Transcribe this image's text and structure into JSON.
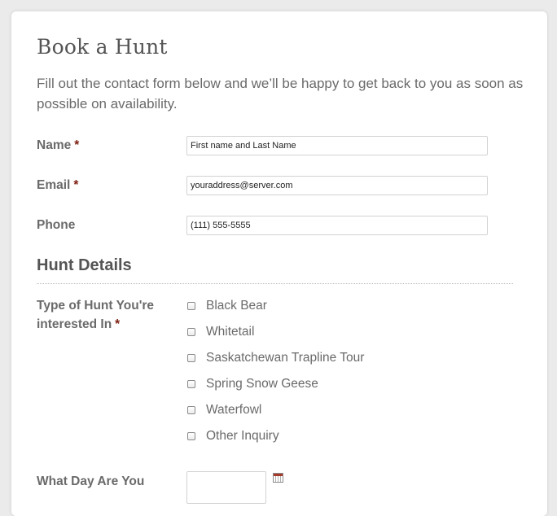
{
  "page": {
    "title": "Book a Hunt",
    "intro": "Fill out the contact form below and we’ll be happy to get back to you as soon as possible on availability."
  },
  "form": {
    "name": {
      "label": "Name",
      "required_mark": "*",
      "value": "First name and Last Name"
    },
    "email": {
      "label": "Email",
      "required_mark": "*",
      "value": "youraddress@server.com"
    },
    "phone": {
      "label": "Phone",
      "value": "(111) 555-5555"
    }
  },
  "hunt_details": {
    "section_title": "Hunt Details",
    "hunt_type": {
      "label_line1": "Type of Hunt You're",
      "label_line2": "interested In",
      "required_mark": "*",
      "options": [
        {
          "label": "Black Bear",
          "checked": false
        },
        {
          "label": "Whitetail",
          "checked": false
        },
        {
          "label": "Saskatchewan Trapline Tour",
          "checked": false
        },
        {
          "label": "Spring Snow Geese",
          "checked": false
        },
        {
          "label": "Waterfowl",
          "checked": false
        },
        {
          "label": "Other Inquiry",
          "checked": false
        }
      ]
    },
    "date": {
      "label": "What Day Are You",
      "value": "",
      "icon": "calendar-icon"
    }
  },
  "colors": {
    "required": "#7d1d10",
    "text": "#6a6a6a",
    "heading": "#555555",
    "background": "#ebebeb"
  }
}
